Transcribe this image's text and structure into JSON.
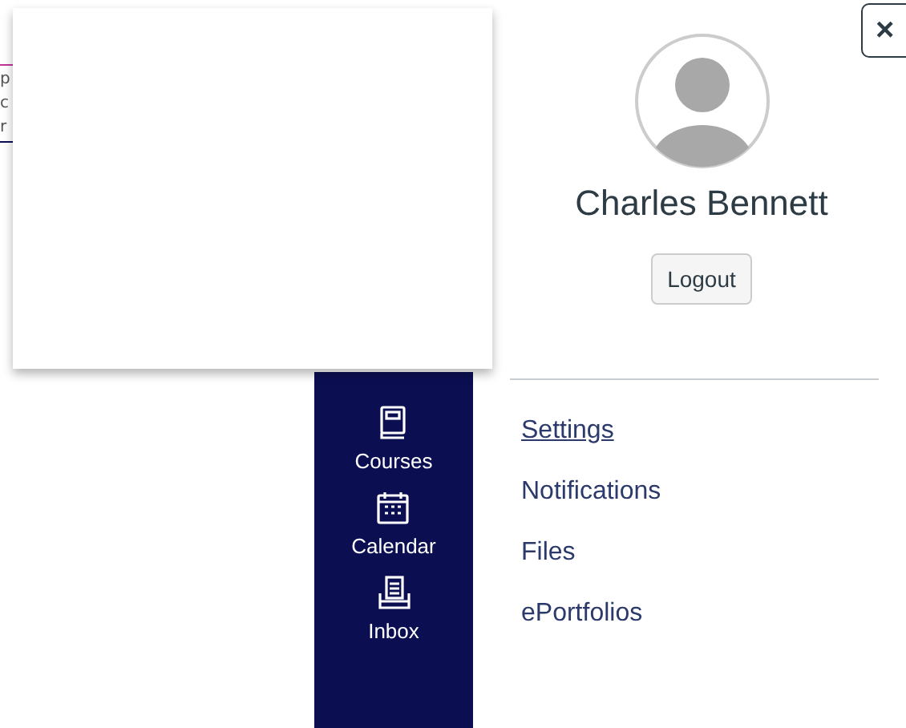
{
  "background_fragments": [
    "p",
    "c",
    "r"
  ],
  "nav": [
    {
      "label": "Courses",
      "kind": "book"
    },
    {
      "label": "Calendar",
      "kind": "calendar"
    },
    {
      "label": "Inbox",
      "kind": "inbox"
    }
  ],
  "profile": {
    "name": "Charles Bennett",
    "logout": "Logout",
    "close": "×"
  },
  "links": [
    {
      "label": "Settings",
      "selected": true
    },
    {
      "label": "Notifications",
      "selected": false
    },
    {
      "label": "Files",
      "selected": false
    },
    {
      "label": "ePortfolios",
      "selected": false
    }
  ]
}
